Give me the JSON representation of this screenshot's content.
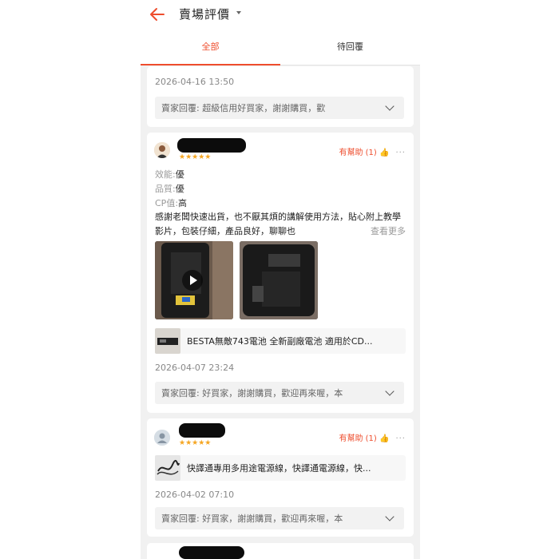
{
  "header": {
    "title": "賣場評價"
  },
  "tabs": [
    {
      "label": "全部"
    },
    {
      "label": "待回覆"
    }
  ],
  "reviews": [
    {
      "date": "2026-04-16 13:50",
      "reply": "賣家回覆: 超級信用好買家，謝謝購買，歡"
    },
    {
      "stars": "★★★★★",
      "helpful": "有幫助 (1) 👍",
      "more": "···",
      "attrs": [
        {
          "key": "效能:",
          "value": "優"
        },
        {
          "key": "品質:",
          "value": "優"
        },
        {
          "key": "CP值:",
          "value": "高"
        }
      ],
      "text": "感謝老闆快速出貨，也不厭其煩的講解使用方法，貼心附上教學影片，包裝仔細，產品良好，聊聊也",
      "see_more": "查看更多",
      "product": "BESTA無敵743電池 全新副廠電池 適用於CD...",
      "date": "2026-04-07 23:24",
      "reply": "賣家回覆: 好買家，謝謝購買，歡迎再來喔，本"
    },
    {
      "stars": "★★★★★",
      "helpful": "有幫助 (1) 👍",
      "more": "···",
      "product": "快譯通專用多用途電源線，快譯通電源線，快...",
      "date": "2026-04-02 07:10",
      "reply": "賣家回覆: 好買家，謝謝購買，歡迎再來喔，本"
    }
  ],
  "colors": {
    "accent": "#ee4d2d",
    "star": "#f5a623"
  }
}
